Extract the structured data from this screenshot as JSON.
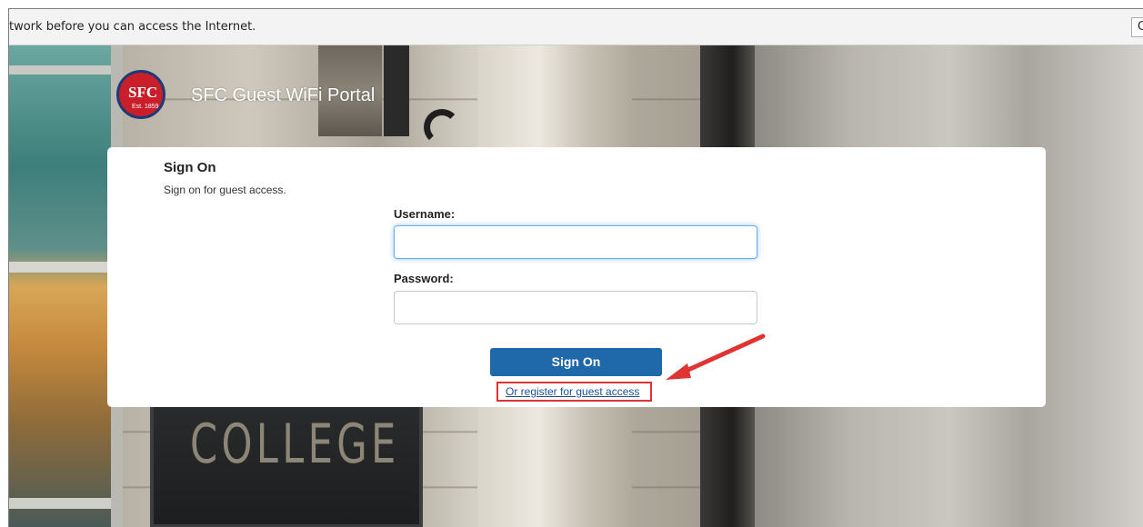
{
  "notification": {
    "message": "twork before you can access the Internet.",
    "button_label": "O"
  },
  "header": {
    "logo_text": "SFC",
    "logo_year": "Est. 1859",
    "title": "SFC Guest WiFi Portal"
  },
  "background": {
    "plaque_text": "COLLEGE"
  },
  "signon": {
    "title": "Sign On",
    "subtitle": "Sign on for guest access.",
    "username_label": "Username:",
    "username_value": "",
    "password_label": "Password:",
    "password_value": "",
    "submit_label": "Sign On",
    "register_link": "Or register for guest access"
  },
  "annotation": {
    "highlight_color": "#e03333"
  }
}
